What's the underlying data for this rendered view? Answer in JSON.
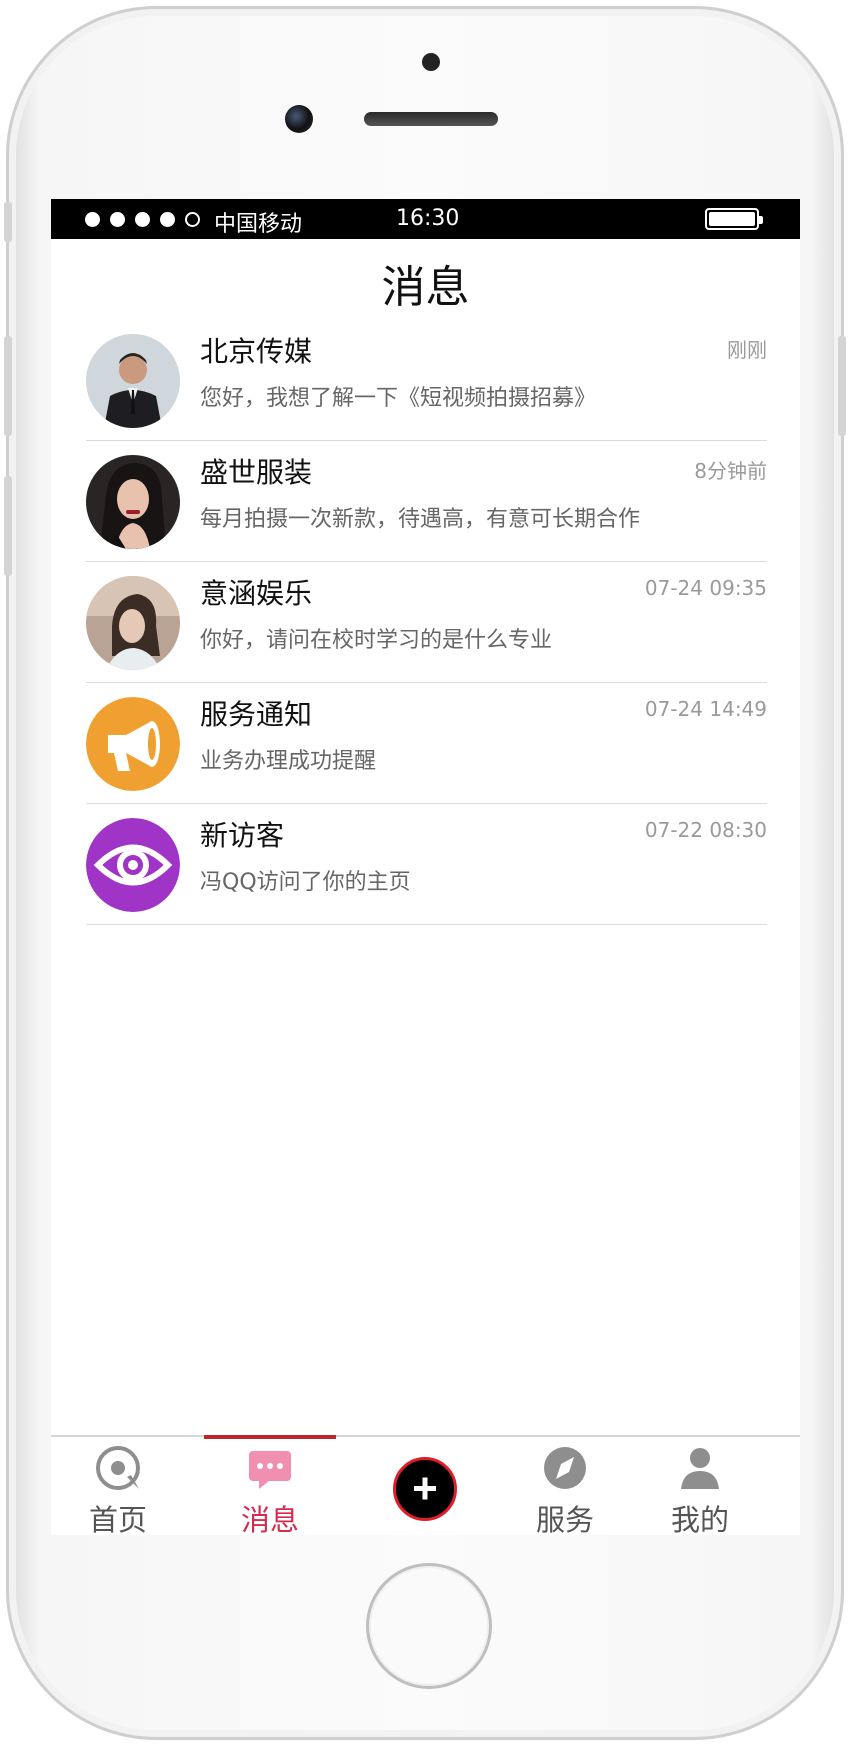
{
  "status_bar": {
    "carrier": "中国移动",
    "time": "16:30"
  },
  "header": {
    "title": "消息"
  },
  "messages": [
    {
      "name": "北京传媒",
      "time": "刚刚",
      "preview": "您好，我想了解一下《短视频拍摄招募》",
      "avatar": "person-avatar"
    },
    {
      "name": "盛世服装",
      "time": "8分钟前",
      "preview": "每月拍摄一次新款，待遇高，有意可长期合作",
      "avatar": "person-avatar"
    },
    {
      "name": "意涵娱乐",
      "time": "07-24 09:35",
      "preview": "你好，请问在校时学习的是什么专业",
      "avatar": "person-avatar"
    },
    {
      "name": "服务通知",
      "time": "07-24 14:49",
      "preview": "业务办理成功提醒",
      "avatar": "megaphone-icon",
      "color": "#f0a030"
    },
    {
      "name": "新访客",
      "time": "07-22 08:30",
      "preview": "冯QQ访问了你的主页",
      "avatar": "eye-icon",
      "color": "#a034c6"
    }
  ],
  "tabbar": {
    "items": [
      {
        "label": "首页",
        "icon": "home-icon"
      },
      {
        "label": "消息",
        "icon": "message-icon",
        "active": true
      },
      {
        "label": "",
        "icon": "plus-icon"
      },
      {
        "label": "服务",
        "icon": "compass-icon"
      },
      {
        "label": "我的",
        "icon": "user-icon"
      }
    ]
  },
  "colors": {
    "accent": "#d8294f",
    "indicator": "#c0242c"
  }
}
